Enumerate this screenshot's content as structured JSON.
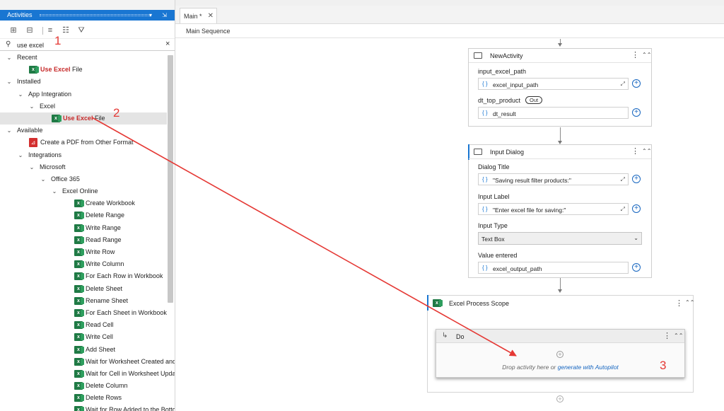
{
  "panel": {
    "title": "Activities",
    "title_tools": "▾ ⇲",
    "search_value": "use excel",
    "tree": [
      {
        "indent": 0,
        "chev": "⌄",
        "label": "Recent"
      },
      {
        "indent": 1,
        "icon": "excel",
        "hl": "Use Excel",
        "rest": " File"
      },
      {
        "indent": 0,
        "chev": "⌄",
        "label": "Installed"
      },
      {
        "indent": 1,
        "chev": "⌄",
        "label": "App Integration"
      },
      {
        "indent": 2,
        "chev": "⌄",
        "label": "Excel"
      },
      {
        "indent": 3,
        "icon": "excel",
        "hl": "Use Excel",
        "rest": " File",
        "selected": true
      },
      {
        "indent": 0,
        "chev": "⌄",
        "label": "Available"
      },
      {
        "indent": 1,
        "icon": "pdf",
        "label": "Create a PDF from Other Format"
      },
      {
        "indent": 1,
        "chev": "⌄",
        "label": "Integrations"
      },
      {
        "indent": 2,
        "chev": "⌄",
        "label": "Microsoft"
      },
      {
        "indent": 3,
        "chev": "⌄",
        "label": "Office 365"
      },
      {
        "indent": 4,
        "chev": "⌄",
        "label": "Excel Online"
      },
      {
        "indent": 5,
        "icon": "excel",
        "label": "Create Workbook"
      },
      {
        "indent": 5,
        "icon": "excel",
        "label": "Delete Range"
      },
      {
        "indent": 5,
        "icon": "excel",
        "label": "Write Range"
      },
      {
        "indent": 5,
        "icon": "excel",
        "label": "Read Range"
      },
      {
        "indent": 5,
        "icon": "excel",
        "label": "Write Row"
      },
      {
        "indent": 5,
        "icon": "excel",
        "label": "Write Column"
      },
      {
        "indent": 5,
        "icon": "excel",
        "label": "For Each Row in Workbook"
      },
      {
        "indent": 5,
        "icon": "excel",
        "label": "Delete Sheet"
      },
      {
        "indent": 5,
        "icon": "excel",
        "label": "Rename Sheet"
      },
      {
        "indent": 5,
        "icon": "excel",
        "label": "For Each Sheet in Workbook"
      },
      {
        "indent": 5,
        "icon": "excel",
        "label": "Read Cell"
      },
      {
        "indent": 5,
        "icon": "excel",
        "label": "Write Cell"
      },
      {
        "indent": 5,
        "icon": "excel",
        "label": "Add Sheet"
      },
      {
        "indent": 5,
        "icon": "excel",
        "label": "Wait for Worksheet Created and"
      },
      {
        "indent": 5,
        "icon": "excel",
        "label": "Wait for Cell in Worksheet Upda"
      },
      {
        "indent": 5,
        "icon": "excel",
        "label": "Delete Column"
      },
      {
        "indent": 5,
        "icon": "excel",
        "label": "Delete Rows"
      },
      {
        "indent": 5,
        "icon": "excel",
        "label": "Wait for Row Added to the Botto"
      }
    ]
  },
  "editor": {
    "tab_label": "Main *",
    "breadcrumb": "Main Sequence",
    "new_activity": {
      "title": "NewActivity",
      "field1_label": "input_excel_path",
      "field1_value": "excel_input_path",
      "field2_label": "dt_top_product",
      "field2_badge": "Out",
      "field2_value": "dt_result"
    },
    "input_dialog": {
      "title": "Input Dialog",
      "dialog_title_label": "Dialog Title",
      "dialog_title_value": "\"Saving result filter products:\"",
      "input_label_label": "Input Label",
      "input_label_value": "\"Enter excel file for saving:\"",
      "input_type_label": "Input Type",
      "input_type_value": "Text Box",
      "value_entered_label": "Value entered",
      "value_entered_value": "excel_output_path"
    },
    "scope": {
      "title": "Excel Process Scope",
      "do_title": "Do",
      "drop_hint": "Drop activity here or ",
      "drop_link": "generate with Autopilot"
    }
  },
  "annotations": {
    "n1": "1",
    "n2": "2",
    "n3": "3",
    "arrow_color": "#e53935"
  },
  "colors": {
    "accent": "#1976d2",
    "highlight": "#c62828",
    "excel": "#1f7a45"
  }
}
